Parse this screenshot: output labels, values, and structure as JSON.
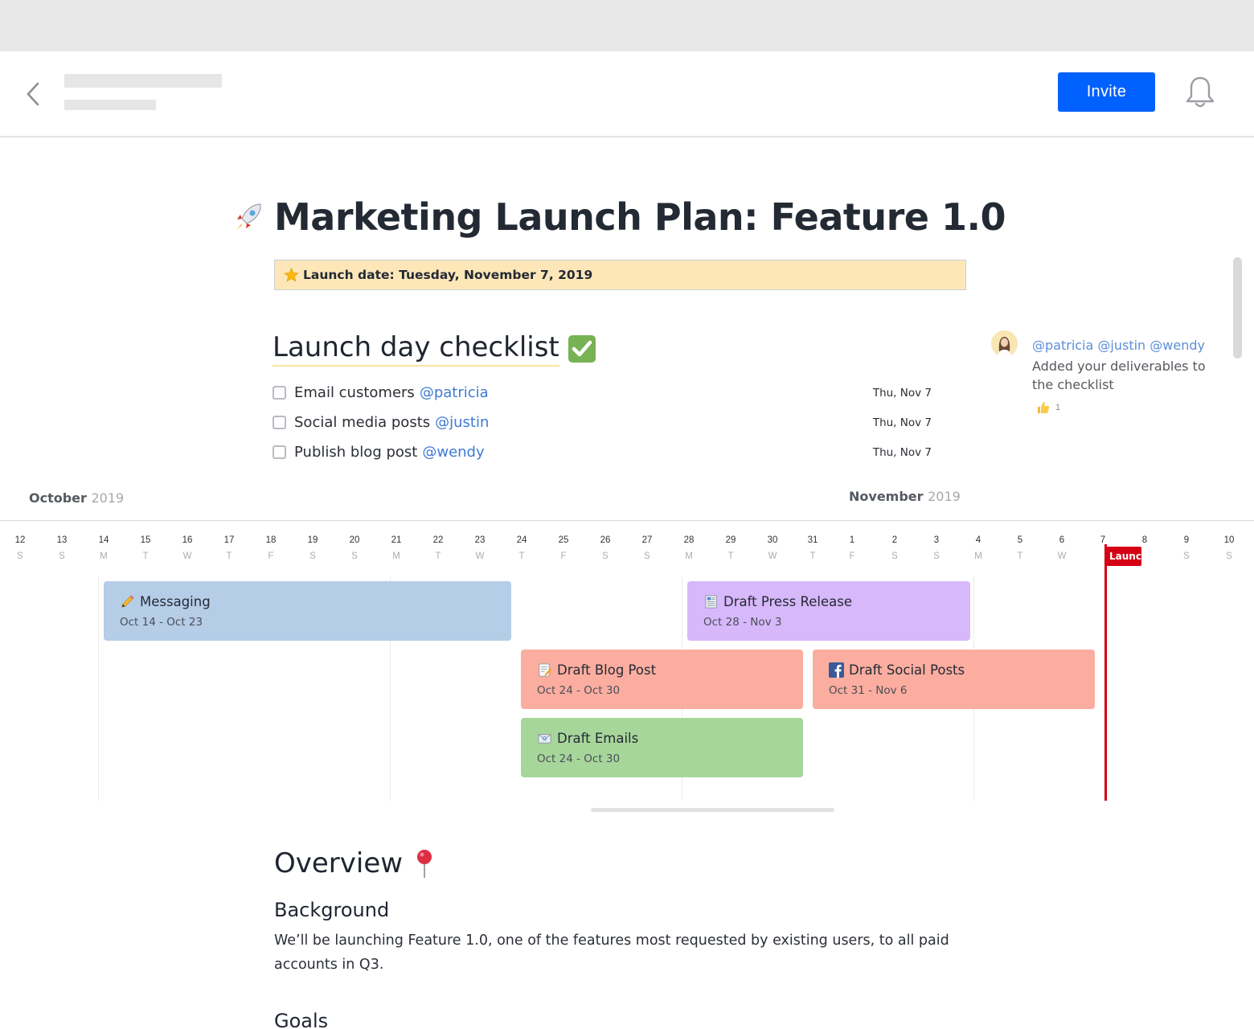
{
  "header": {
    "invite_label": "Invite"
  },
  "doc": {
    "title": "Marketing Launch Plan: Feature 1.0",
    "banner": "Launch date: Tuesday, November 7, 2019"
  },
  "checklist": {
    "heading": "Launch day checklist",
    "tasks": [
      {
        "label": "Email customers",
        "mention": "@patricia",
        "date": "Thu, Nov 7"
      },
      {
        "label": "Social media posts",
        "mention": "@justin",
        "date": "Thu, Nov 7"
      },
      {
        "label": "Publish blog post",
        "mention": "@wendy",
        "date": "Thu, Nov 7"
      }
    ]
  },
  "comment": {
    "mentions": "@patricia @justin @wendy",
    "text": "Added your deliverables to the checklist",
    "likes": "1"
  },
  "timeline": {
    "months": [
      {
        "name": "October",
        "year": "2019"
      },
      {
        "name": "November",
        "year": "2019"
      }
    ],
    "days": [
      {
        "n": "12",
        "w": "S"
      },
      {
        "n": "13",
        "w": "S"
      },
      {
        "n": "14",
        "w": "M"
      },
      {
        "n": "15",
        "w": "T"
      },
      {
        "n": "16",
        "w": "W"
      },
      {
        "n": "17",
        "w": "T"
      },
      {
        "n": "18",
        "w": "F"
      },
      {
        "n": "19",
        "w": "S"
      },
      {
        "n": "20",
        "w": "S"
      },
      {
        "n": "21",
        "w": "M"
      },
      {
        "n": "22",
        "w": "T"
      },
      {
        "n": "23",
        "w": "W"
      },
      {
        "n": "24",
        "w": "T"
      },
      {
        "n": "25",
        "w": "F"
      },
      {
        "n": "26",
        "w": "S"
      },
      {
        "n": "27",
        "w": "S"
      },
      {
        "n": "28",
        "w": "M"
      },
      {
        "n": "29",
        "w": "T"
      },
      {
        "n": "30",
        "w": "W"
      },
      {
        "n": "31",
        "w": "T"
      },
      {
        "n": "1",
        "w": "F"
      },
      {
        "n": "2",
        "w": "S"
      },
      {
        "n": "3",
        "w": "S"
      },
      {
        "n": "4",
        "w": "M"
      },
      {
        "n": "5",
        "w": "T"
      },
      {
        "n": "6",
        "w": "W"
      },
      {
        "n": "7",
        "w": ""
      },
      {
        "n": "8",
        "w": ""
      },
      {
        "n": "9",
        "w": "S"
      },
      {
        "n": "10",
        "w": "S"
      }
    ],
    "bars": [
      {
        "title": "Messaging",
        "dates": "Oct 14 - Oct 23",
        "icon": "pencil-icon",
        "color": "#b6cde8"
      },
      {
        "title": "Draft Press Release",
        "dates": "Oct 28 - Nov 3",
        "icon": "newspaper-icon",
        "color": "#d7b8fb"
      },
      {
        "title": "Draft Blog Post",
        "dates": "Oct 24 - Oct 30",
        "icon": "memo-icon",
        "color": "#fbada0"
      },
      {
        "title": "Draft Social Posts",
        "dates": "Oct 31 - Nov 6",
        "icon": "facebook-icon",
        "color": "#fbada0"
      },
      {
        "title": "Draft Emails",
        "dates": "Oct 24 - Oct 30",
        "icon": "envelope-icon",
        "color": "#a7d69b"
      }
    ],
    "launch_label": "Launch",
    "launch_color": "#d40013"
  },
  "overview": {
    "heading": "Overview",
    "background_heading": "Background",
    "background_text": "We’ll be launching Feature 1.0, one of the features most requested by existing users, to all paid accounts in Q3.",
    "goals_heading": "Goals"
  },
  "colors": {
    "accent": "#0061fe",
    "mention": "#3d7ad6",
    "banner": "#fde7b8"
  }
}
